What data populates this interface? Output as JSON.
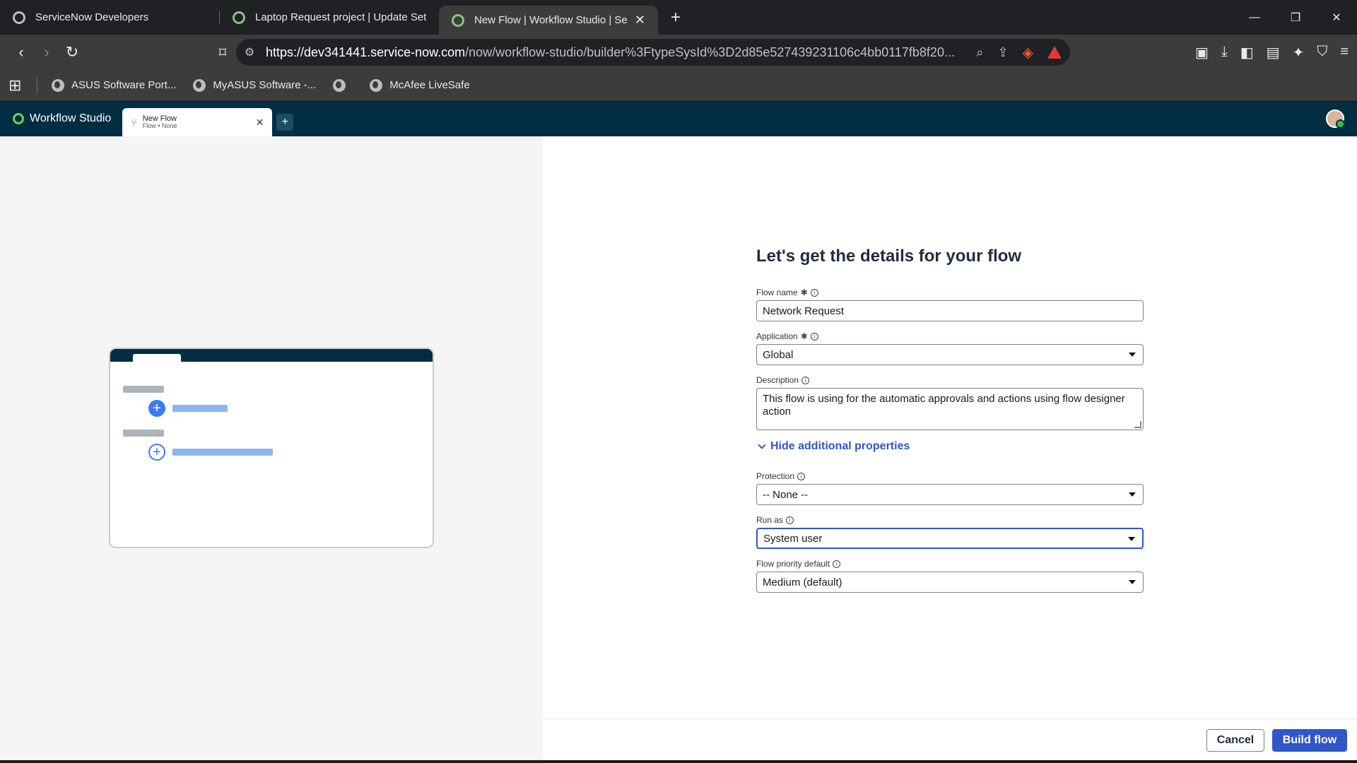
{
  "browser": {
    "tabs": [
      {
        "label": "ServiceNow Developers",
        "active": false
      },
      {
        "label": "Laptop Request project | Update Set",
        "active": false
      },
      {
        "label": "New Flow | Workflow Studio | Se",
        "active": true
      }
    ],
    "new_tab_icon": "plus-icon",
    "url_host": "https://dev341441.service-now.com",
    "url_path": "/now/workflow-studio/builder%3FtypeSysId%3D2d85e527439231106c4bb0117fb8f20...",
    "bookmarks": [
      {
        "label": "ASUS Software Port..."
      },
      {
        "label": "MyASUS Software -..."
      },
      {
        "label": ""
      },
      {
        "label": "McAfee LiveSafe"
      }
    ]
  },
  "studio": {
    "brand": "Workflow Studio",
    "tab_title": "New Flow",
    "tab_subtitle": "Flow • None",
    "add_label": "+"
  },
  "form": {
    "heading": "Let's get the details for your flow",
    "flow_name_label": "Flow name",
    "flow_name_value": "Network Request",
    "application_label": "Application",
    "application_value": "Global",
    "description_label": "Description",
    "description_value": "This flow is  using for the automatic approvals and actions using flow designer action",
    "toggle_label": "Hide additional properties",
    "protection_label": "Protection",
    "protection_value": "-- None --",
    "run_as_label": "Run as",
    "run_as_value": "System user",
    "priority_label": "Flow priority default",
    "priority_value": "Medium (default)"
  },
  "footer": {
    "cancel_label": "Cancel",
    "build_label": "Build flow"
  },
  "colors": {
    "accent": "#3156c9",
    "studio_bar": "#032d42",
    "brand_green": "#62d84e"
  }
}
